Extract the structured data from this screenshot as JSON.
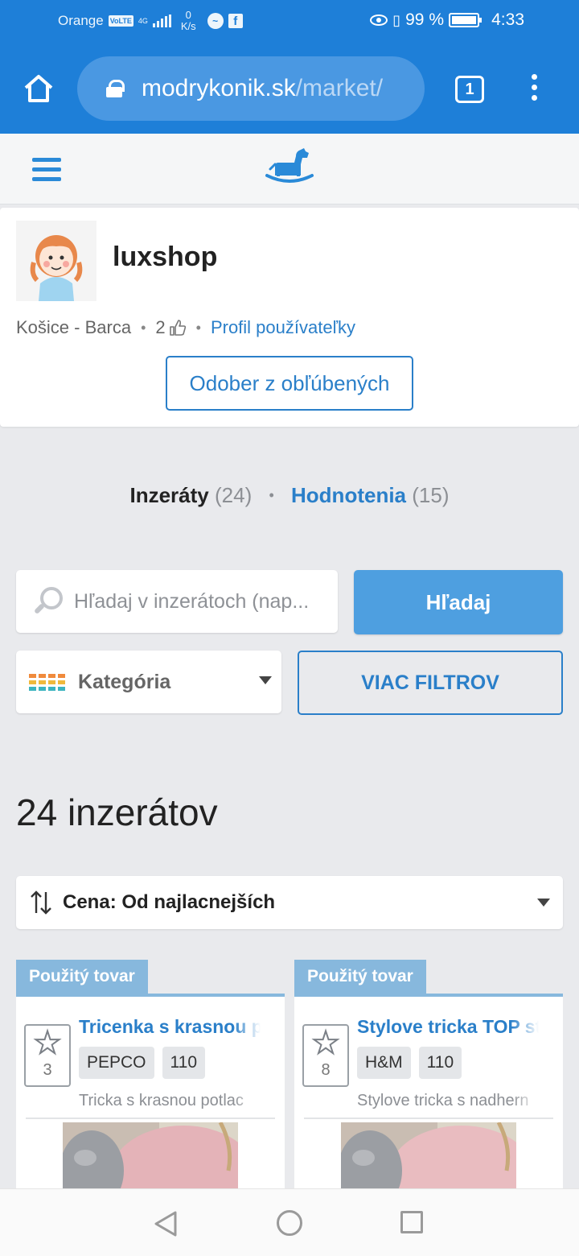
{
  "status_bar": {
    "carrier": "Orange",
    "volte": "VoLTE",
    "network": "4G",
    "speed_value": "0",
    "speed_unit": "K/s",
    "battery": "99 %",
    "battery_level": 0.99,
    "time": "4:33",
    "icons": [
      "messenger-icon",
      "facebook-icon",
      "eye-icon",
      "vibrate-icon",
      "battery-icon"
    ]
  },
  "browser": {
    "url_host": "modrykonik.sk",
    "url_path": "/market/",
    "tab_count": "1",
    "icons": [
      "home-icon",
      "lock-icon",
      "tabs-icon",
      "more-vert-icon"
    ]
  },
  "site": {
    "logo": "rocking-horse-logo",
    "menu_icon": "hamburger-icon",
    "accent": "#2a7fc9"
  },
  "profile": {
    "name": "luxshop",
    "location": "Košice - Barca",
    "likes": "2",
    "profile_link": "Profil používateľky",
    "unfollow_label": "Odober z obľúbených"
  },
  "tabs": {
    "ads_label": "Inzeráty",
    "ads_count": "(24)",
    "reviews_label": "Hodnotenia",
    "reviews_count": "(15)"
  },
  "search": {
    "placeholder": "Hľadaj v inzerátoch (nap...",
    "value": "",
    "button": "Hľadaj",
    "category_label": "Kategória",
    "more_filters": "VIAC FILTROV"
  },
  "results": {
    "count_title": "24 inzerátov",
    "sort_label": "Cena: Od najlacnejších"
  },
  "listings": [
    {
      "badge": "Použitý tovar",
      "title": "Tricenka s krasnou p",
      "brand": "PEPCO",
      "size": "110",
      "desc": "Tricka s krasnou potlac",
      "stars": "3"
    },
    {
      "badge": "Použitý tovar",
      "title": "Stylove tricka TOP st",
      "brand": "H&M",
      "size": "110",
      "desc": "Stylove tricka s nadhern",
      "stars": "8"
    }
  ],
  "nav": {
    "icons": [
      "back-icon",
      "home-circle-icon",
      "recents-icon"
    ]
  }
}
